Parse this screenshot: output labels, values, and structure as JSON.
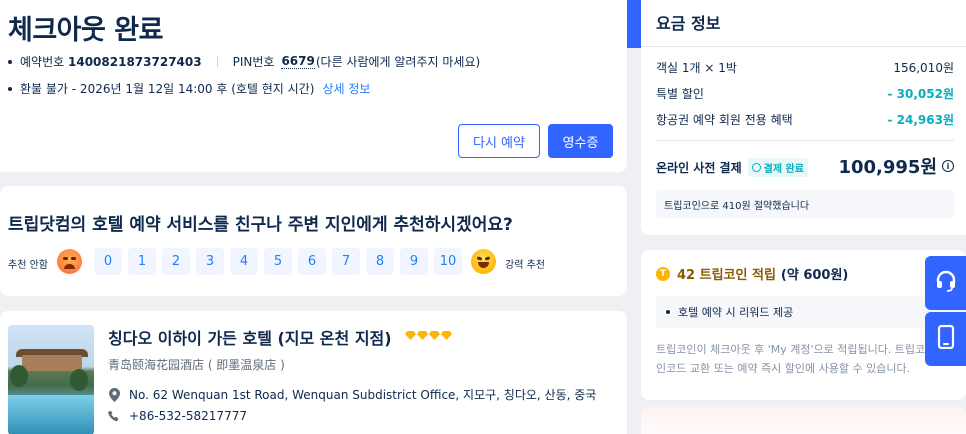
{
  "checkout": {
    "title": "체크아웃 완료",
    "booking_label": "예약번호",
    "booking_no": "1400821873727403",
    "pin_label": "PIN번호",
    "pin": "6679",
    "pin_note": "(다른 사람에게 알려주지 마세요)",
    "refund_text": "환불 불가 - 2026년 1월 12일 14:00 후 (호텔 현지 시간)",
    "refund_link": "상세 정보",
    "rebook_button": "다시 예약",
    "receipt_button": "영수증"
  },
  "survey": {
    "question": "트립닷컴의 호텔 예약 서비스를 친구나 주변 지인에게 추천하시겠어요?",
    "low_label": "추천 안함",
    "high_label": "강력 추천",
    "scores": [
      "0",
      "1",
      "2",
      "3",
      "4",
      "5",
      "6",
      "7",
      "8",
      "9",
      "10"
    ]
  },
  "hotel": {
    "name": "칭다오 이하이 가든 호텔 (지모 온천 지점)",
    "local_name": "青岛颐海花园酒店 ( 即墨温泉店 )",
    "address": "No. 62 Wenquan 1st Road, Wenquan Subdistrict Office, 지모구, 칭다오, 산동, 중국",
    "phone": "+86-532-58217777",
    "diamond_rating": 4
  },
  "pricing": {
    "title": "요금 정보",
    "rows": [
      {
        "label": "객실 1개 × 1박",
        "value": "156,010원"
      },
      {
        "label": "특별 할인",
        "value": "- 30,052원"
      },
      {
        "label": "항공권 예약 회원 전용 혜택",
        "value": "- 24,963원"
      }
    ],
    "total_label": "온라인 사전 결제",
    "paid_badge": "결제 완료",
    "total_value": "100,995원",
    "savings_note": "트립코인으로 410원 절약했습니다"
  },
  "tripcoins": {
    "title_highlight": "42 트립코인 적립",
    "title_rest": "(약 600원)",
    "bullet": "호텔 예약 시 리워드 제공",
    "description": "트립코인이 체크아웃 후 'My 계정'으로 적립됩니다. 트립코인은 할인코드 교환 또는 예약 즉시 할인에 사용할 수 있습니다."
  },
  "colors": {
    "primary": "#3264ff",
    "text": "#0f294d",
    "discount": "#06aebd",
    "link": "#287dfa",
    "coin": "#ffb400"
  }
}
